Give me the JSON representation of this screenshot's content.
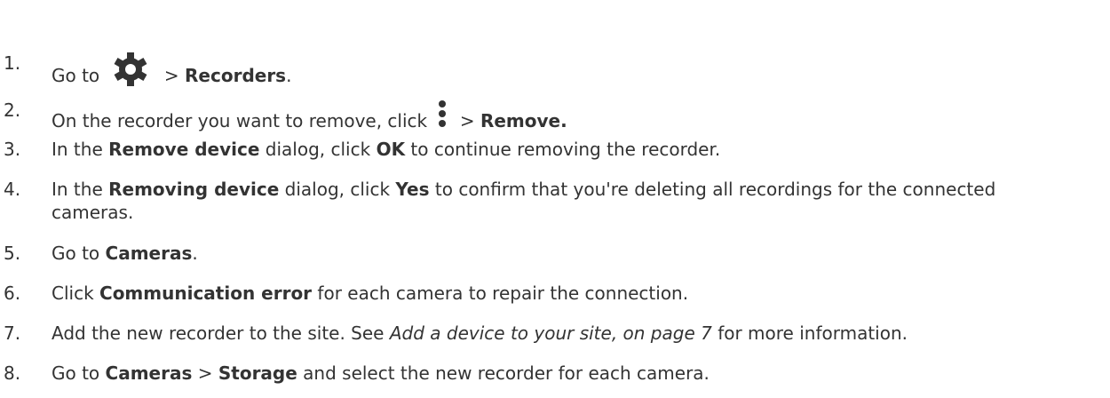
{
  "steps": [
    {
      "num": "1.",
      "pre": "Go to",
      "post": " > ",
      "bold1": "Recorders",
      "end": ".",
      "icon": "gear-icon"
    },
    {
      "num": "2.",
      "pre": "On the recorder you want to remove, click",
      "post": " > ",
      "bold1": "Remove.",
      "icon": "more-vertical-icon"
    },
    {
      "num": "3.",
      "t1": "In the ",
      "b1": "Remove device",
      "t2": " dialog, click ",
      "b2": "OK",
      "t3": " to continue removing the recorder."
    },
    {
      "num": "4.",
      "t1": "In the ",
      "b1": "Removing device",
      "t2": " dialog, click ",
      "b2": "Yes",
      "t3": " to confirm that you're deleting all recordings for the connected",
      "t4": "cameras."
    },
    {
      "num": "5.",
      "t1": "Go to ",
      "b1": "Cameras",
      "t2": "."
    },
    {
      "num": "6.",
      "t1": "Click ",
      "b1": "Communication error",
      "t2": " for each camera to repair the connection."
    },
    {
      "num": "7.",
      "t1": "Add the new recorder to the site. See ",
      "i1": "Add a device to your site, on page 7",
      "t2": " for more information."
    },
    {
      "num": "8.",
      "t1": "Go to ",
      "b1": "Cameras",
      "t2": " > ",
      "b2": "Storage",
      "t3": " and select the new recorder for each camera."
    }
  ]
}
